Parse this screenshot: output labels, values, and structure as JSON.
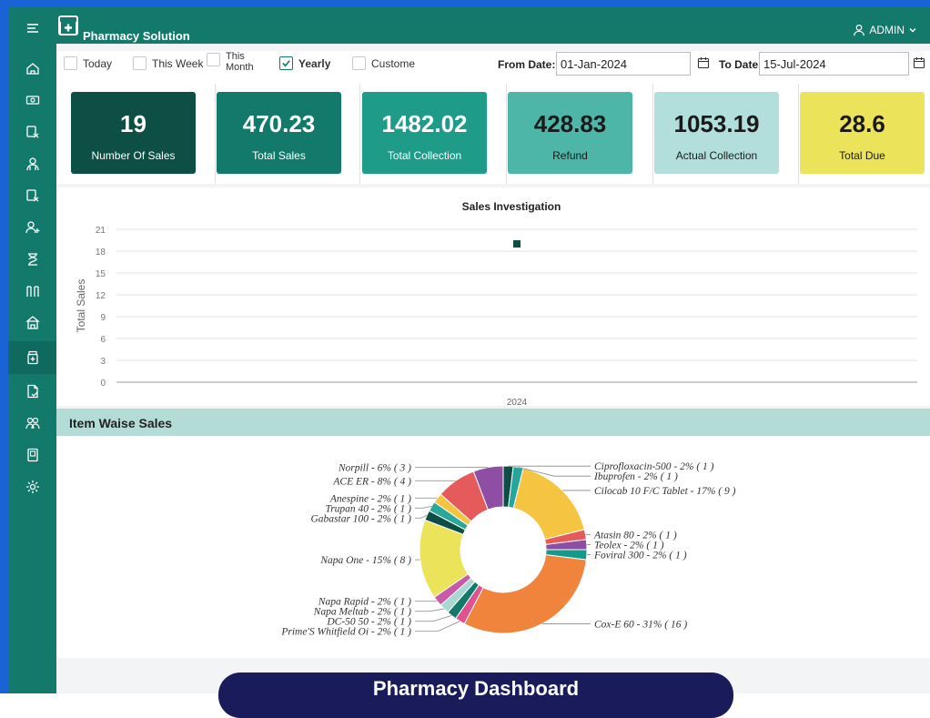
{
  "app": {
    "title": "Pharmacy Solution",
    "user": "ADMIN"
  },
  "sidebar": {
    "items": [
      {
        "icon": "menu-icon"
      },
      {
        "icon": "home-icon"
      },
      {
        "icon": "cash-icon"
      },
      {
        "icon": "prescription-icon"
      },
      {
        "icon": "users-icon"
      },
      {
        "icon": "prescription-icon"
      },
      {
        "icon": "add-user-icon"
      },
      {
        "icon": "hourglass-icon"
      },
      {
        "icon": "columns-icon"
      },
      {
        "icon": "building-icon"
      },
      {
        "icon": "medicine-icon"
      },
      {
        "icon": "document-icon"
      },
      {
        "icon": "group-icon"
      },
      {
        "icon": "panel-icon"
      },
      {
        "icon": "settings-icon"
      }
    ]
  },
  "filters": {
    "today": "Today",
    "this_week": "This Week",
    "this_month_1": "This",
    "this_month_2": "Month",
    "yearly": "Yearly",
    "custome": "Custome",
    "from_label": "From Date:",
    "from_value": "01-Jan-2024",
    "to_label": "To Date:",
    "to_value": "15-Jul-2024"
  },
  "cards": [
    {
      "value": "19",
      "label": "Number Of Sales",
      "bg": "#0e4f45",
      "fg": "#ffffff"
    },
    {
      "value": "470.23",
      "label": "Total Sales",
      "bg": "#137a6b",
      "fg": "#ffffff"
    },
    {
      "value": "1482.02",
      "label": "Total Collection",
      "bg": "#1f9b8a",
      "fg": "#ffffff"
    },
    {
      "value": "428.83",
      "label": "Refund",
      "bg": "#4db6a8",
      "fg": "#1a1a1a"
    },
    {
      "value": "1053.19",
      "label": "Actual Collection",
      "bg": "#b2dfdb",
      "fg": "#1a1a1a"
    },
    {
      "value": "28.6",
      "label": "Total Due",
      "bg": "#ebe45a",
      "fg": "#1a1a1a"
    }
  ],
  "chart_data": [
    {
      "type": "scatter",
      "title": "Sales Investigation",
      "ylabel": "Total Sales",
      "xlabel": "",
      "categories": [
        "2024"
      ],
      "values": [
        19
      ],
      "yticks": [
        0,
        3,
        6,
        9,
        12,
        15,
        18,
        21
      ],
      "ylim": [
        0,
        21
      ],
      "grid": true,
      "color": "#0e4f45"
    },
    {
      "type": "pie",
      "title": "Item Waise Sales",
      "slices": [
        {
          "name": "Ciprofloxacin-500",
          "pct": 2,
          "count": 1,
          "color": "#0e4f45",
          "label": "Ciprofloxacin-500 - 2% ( 1 )"
        },
        {
          "name": "Ibuprofen",
          "pct": 2,
          "count": 1,
          "color": "#26a69a",
          "label": "Ibuprofen - 2% ( 1 )"
        },
        {
          "name": "Cilocab 10 F/C Tablet",
          "pct": 17,
          "count": 9,
          "color": "#f5c542",
          "label": "Cilocab 10 F/C Tablet - 17% ( 9 )"
        },
        {
          "name": "Atasin 80",
          "pct": 2,
          "count": 1,
          "color": "#e55b5b",
          "label": "Atasin 80 - 2% ( 1 )"
        },
        {
          "name": "Teolex",
          "pct": 2,
          "count": 1,
          "color": "#8e4ea3",
          "label": "Teolex - 2% ( 1 )"
        },
        {
          "name": "Foviral 300",
          "pct": 2,
          "count": 1,
          "color": "#149a8a",
          "label": "Foviral 300 - 2% ( 1 )"
        },
        {
          "name": "Cox-E 60",
          "pct": 31,
          "count": 16,
          "color": "#f0843c",
          "label": "Cox-E 60 - 31% ( 16 )"
        },
        {
          "name": "Prime'S Whitfield Oi",
          "pct": 2,
          "count": 1,
          "color": "#e0528f",
          "label": "Prime'S Whitfield Oi - 2% ( 1 )"
        },
        {
          "name": "DC-50 50",
          "pct": 2,
          "count": 1,
          "color": "#137a6b",
          "label": "DC-50 50 - 2% ( 1 )"
        },
        {
          "name": "Napa Meltab",
          "pct": 2,
          "count": 1,
          "color": "#a8d8d2",
          "label": "Napa Meltab - 2% ( 1 )"
        },
        {
          "name": "Napa Rapid",
          "pct": 2,
          "count": 1,
          "color": "#c85aa8",
          "label": "Napa Rapid - 2% ( 1 )"
        },
        {
          "name": "Napa One",
          "pct": 15,
          "count": 8,
          "color": "#ebe45a",
          "label": "Napa One - 15% ( 8 )"
        },
        {
          "name": "Gabastar 100",
          "pct": 2,
          "count": 1,
          "color": "#0e4f45",
          "label": "Gabastar 100 - 2% ( 1 )"
        },
        {
          "name": "Trupan 40",
          "pct": 2,
          "count": 1,
          "color": "#2aa99b",
          "label": "Trupan 40 - 2% ( 1 )"
        },
        {
          "name": "Anespine",
          "pct": 2,
          "count": 1,
          "color": "#f5c542",
          "label": "Anespine - 2% ( 1 )"
        },
        {
          "name": "ACE ER",
          "pct": 8,
          "count": 4,
          "color": "#e55b5b",
          "label": "ACE ER - 8% ( 4 )"
        },
        {
          "name": "Norpill",
          "pct": 6,
          "count": 3,
          "color": "#8e4ea3",
          "label": "Norpill - 6% ( 3 )"
        }
      ]
    }
  ],
  "banner": "Pharmacy Dashboard"
}
